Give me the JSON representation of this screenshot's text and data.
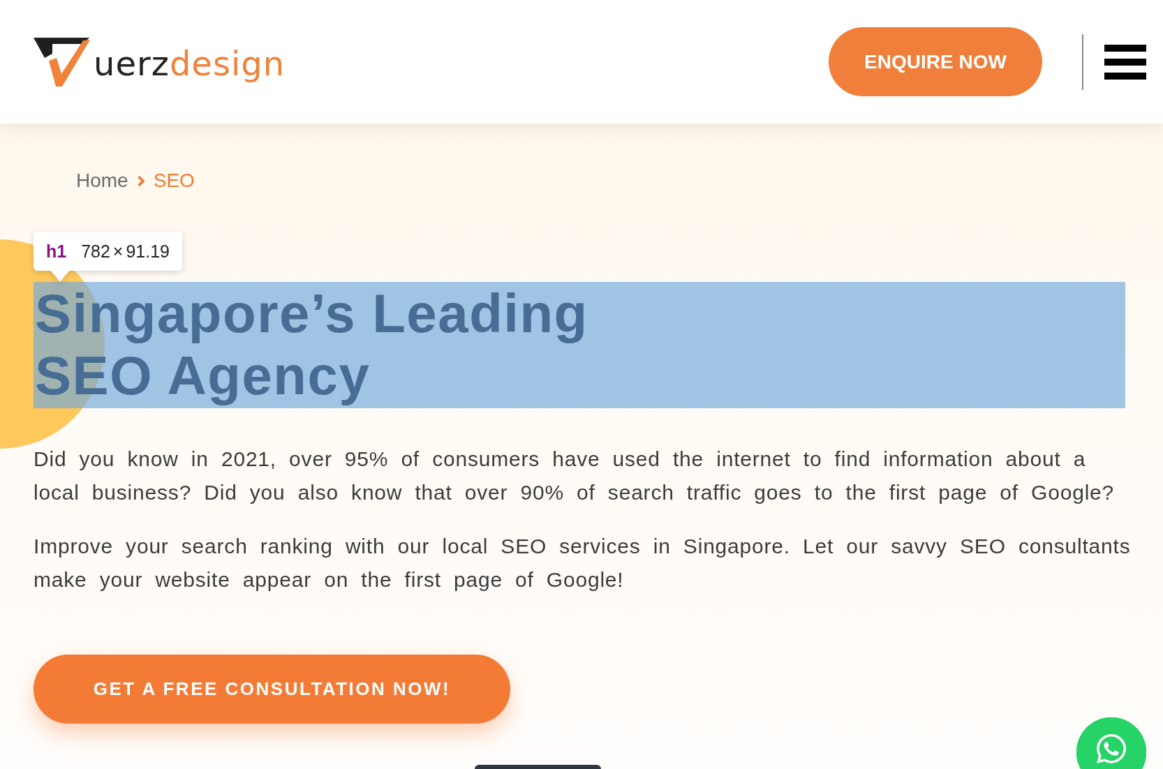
{
  "header": {
    "logo": {
      "wordmark": [
        {
          "text": "uerz",
          "accent": false
        },
        {
          "text": "design",
          "accent": true
        }
      ]
    },
    "enquire_button": "ENQUIRE NOW"
  },
  "breadcrumb": [
    {
      "label": "Home",
      "current": false
    },
    {
      "label": "SEO",
      "current": true
    }
  ],
  "heading": {
    "text": "Singapore’s Leading SEO Agency",
    "inspected": true,
    "inspector_tooltip": {
      "tag": "h1",
      "size": "782 × 91.19"
    }
  },
  "paragraphs": [
    "Did you know in 2021, over 95% of consumers have used the internet to find information about a local business? Did you also know that over 90% of search traffic goes to the first page of Google?",
    "Improve your search ranking with our local SEO services in Singapore. Let our savvy SEO consultants make your website appear on the first page of Google!"
  ],
  "cta_button": "GET A FREE CONSULTATION NOW!"
}
